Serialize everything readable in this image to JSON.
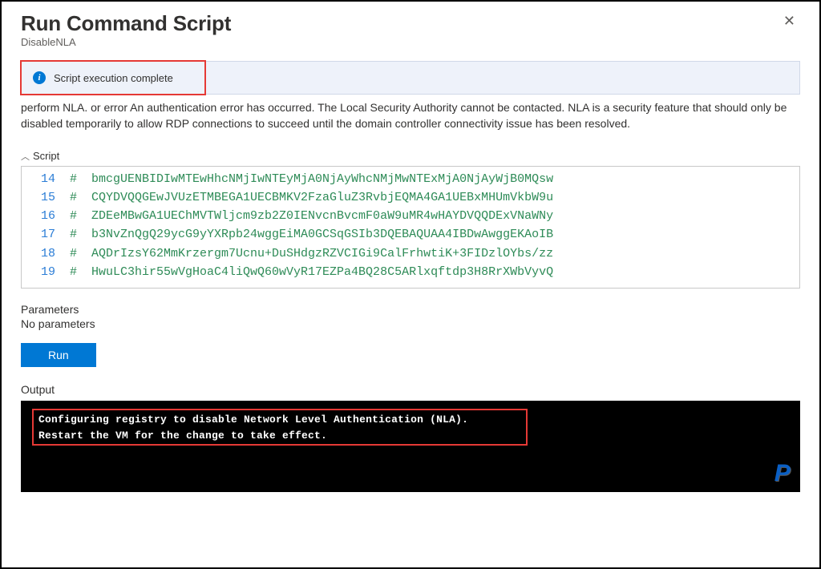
{
  "header": {
    "title": "Run Command Script",
    "subtitle": "DisableNLA"
  },
  "status": {
    "message": "Script execution complete"
  },
  "description": "perform NLA.  or error  An authentication error has occurred. The Local Security Authority cannot be contacted.  NLA is a security feature that should only be disabled temporarily to allow RDP connections to succeed until the domain controller connectivity issue has been resolved.",
  "script": {
    "label": "Script",
    "lines": [
      {
        "n": "14",
        "t": "#  bmcgUENBIDIwMTEwHhcNMjIwNTEyMjA0NjAyWhcNMjMwNTExMjA0NjAyWjB0MQsw"
      },
      {
        "n": "15",
        "t": "#  CQYDVQQGEwJVUzETMBEGA1UECBMKV2FzaGluZ3RvbjEQMA4GA1UEBxMHUmVkbW9u"
      },
      {
        "n": "16",
        "t": "#  ZDEeMBwGA1UEChMVTWljcm9zb2Z0IENvcnBvcmF0aW9uMR4wHAYDVQQDExVNaWNy"
      },
      {
        "n": "17",
        "t": "#  b3NvZnQgQ29ycG9yYXRpb24wggEiMA0GCSqGSIb3DQEBAQUAA4IBDwAwggEKAoIB"
      },
      {
        "n": "18",
        "t": "#  AQDrIzsY62MmKrzergm7Ucnu+DuSHdgzRZVCIGi9CalFrhwtiK+3FIDzlOYbs/zz"
      },
      {
        "n": "19",
        "t": "#  HwuLC3hir55wVgHoaC4liQwQ60wVyR17EZPa4BQ28C5ARlxqftdp3H8RrXWbVyvQ"
      }
    ]
  },
  "parameters": {
    "label": "Parameters",
    "none": "No parameters"
  },
  "actions": {
    "run": "Run"
  },
  "output": {
    "label": "Output",
    "lines": [
      "Configuring registry to disable Network Level Authentication (NLA).",
      "Restart the VM for the change to take effect."
    ]
  },
  "watermark": "P"
}
